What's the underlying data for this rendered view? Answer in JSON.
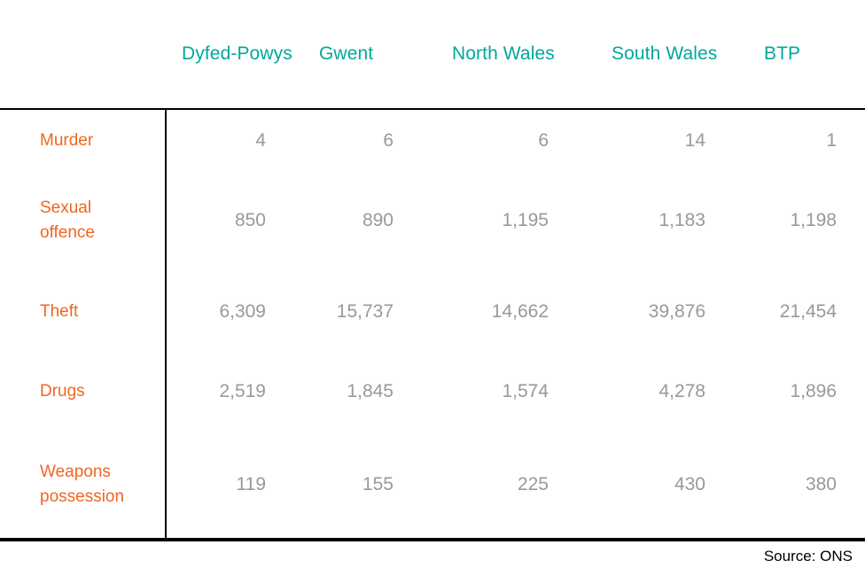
{
  "table": {
    "column_headers": [
      "",
      "Dyfed-Powys",
      "Gwent",
      "North Wales",
      "South Wales",
      "BTP"
    ],
    "rows": [
      {
        "label": "Murder",
        "values": [
          "4",
          "6",
          "6",
          "14",
          "1"
        ]
      },
      {
        "label": "Sexual\noffence",
        "values": [
          "850",
          "890",
          "1,195",
          "1,183",
          "1,198"
        ]
      },
      {
        "label": "Theft",
        "values": [
          "6,309",
          "15,737",
          "14,662",
          "39,876",
          "21,454"
        ]
      },
      {
        "label": "Drugs",
        "values": [
          "2,519",
          "1,845",
          "1,574",
          "4,278",
          "1,896"
        ]
      },
      {
        "label": "Weapons\npossession",
        "values": [
          "119",
          "155",
          "225",
          "430",
          "380"
        ]
      }
    ]
  },
  "footer": {
    "source": "Source: ONS"
  },
  "colors": {
    "header_teal": "#00a89b",
    "row_label_orange": "#f26522",
    "value_gray": "#999999",
    "rule_black": "#000000",
    "background": "#ffffff"
  },
  "chart_data": {
    "type": "table",
    "title": "",
    "categories": [
      "Murder",
      "Sexual offence",
      "Theft",
      "Drugs",
      "Weapons possession"
    ],
    "column_labels": [
      "Dyfed-Powys",
      "Gwent",
      "North Wales",
      "South Wales",
      "BTP"
    ],
    "series": [
      {
        "name": "Dyfed-Powys",
        "values": [
          4,
          850,
          6309,
          2519,
          119
        ]
      },
      {
        "name": "Gwent",
        "values": [
          6,
          890,
          15737,
          1845,
          155
        ]
      },
      {
        "name": "North Wales",
        "values": [
          6,
          1195,
          14662,
          1574,
          225
        ]
      },
      {
        "name": "South Wales",
        "values": [
          14,
          1183,
          39876,
          4278,
          430
        ]
      },
      {
        "name": "BTP",
        "values": [
          1,
          1198,
          21454,
          1896,
          380
        ]
      }
    ],
    "xlabel": "",
    "ylabel": "",
    "grid": false,
    "legend": "none",
    "annotations": [
      "Source: ONS"
    ]
  }
}
